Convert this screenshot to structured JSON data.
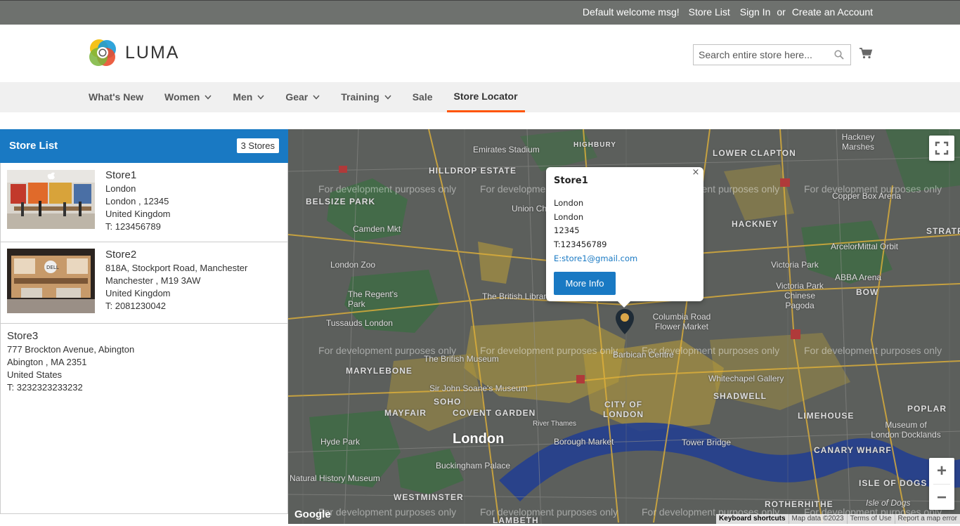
{
  "topbar": {
    "welcome": "Default welcome msg!",
    "store_list": "Store List",
    "sign_in": "Sign In",
    "or": "or",
    "create_account": "Create an Account"
  },
  "header": {
    "logo_text": "LUMA",
    "search_placeholder": "Search entire store here..."
  },
  "nav": {
    "items": [
      {
        "label": "What's New",
        "has_dropdown": false
      },
      {
        "label": "Women",
        "has_dropdown": true
      },
      {
        "label": "Men",
        "has_dropdown": true
      },
      {
        "label": "Gear",
        "has_dropdown": true
      },
      {
        "label": "Training",
        "has_dropdown": true
      },
      {
        "label": "Sale",
        "has_dropdown": false
      },
      {
        "label": "Store Locator",
        "has_dropdown": false,
        "active": true
      }
    ]
  },
  "store_list": {
    "title": "Store List",
    "count_label": "3 Stores",
    "stores": [
      {
        "name": "Store1",
        "line1": "London",
        "line2": "London , 12345",
        "country": "United Kingdom",
        "phone": "T: 123456789"
      },
      {
        "name": "Store2",
        "line1": "818A, Stockport Road, Manchester",
        "line2": "Manchester , M19 3AW",
        "country": "United Kingdom",
        "phone": "T: 2081230042"
      },
      {
        "name": "Store3",
        "line1": "777 Brockton Avenue, Abington",
        "line2": "Abington , MA 2351",
        "country": "United States",
        "phone": "T: 3232323233232"
      }
    ]
  },
  "map": {
    "watermark": "For development purposes only",
    "places": {
      "emirates": "Emirates Stadium",
      "highbury": "HIGHBURY",
      "lower_clapton": "LOWER CLAPTON",
      "hackney_marshes": "Hackney Marshes",
      "hilldrop": "HILLDROP ESTATE",
      "belsize": "BELSIZE PARK",
      "union": "Union Ch",
      "copper_box": "Copper Box Arena",
      "camden": "Camden Mkt",
      "hackney": "HACKNEY",
      "stratford": "STRATFO",
      "arcelor": "ArcelorMittal Orbit",
      "london_zoo": "London Zoo",
      "victoria_park": "Victoria Park",
      "abba": "ABBA Arena",
      "regents_park": "The Regent's Park",
      "british_library": "The British Library",
      "victoria_chinese": "Victoria Park Chinese Pagoda",
      "bow": "BOW",
      "tussauds": "Tussauds London",
      "columbia": "Columbia Road Flower Market",
      "british_museum": "The British Museum",
      "barbican": "Barbican Centre",
      "marylebone": "MARYLEBONE",
      "whitechapel": "Whitechapel Gallery",
      "soane": "Sir John Soane's Museum",
      "soho": "SOHO",
      "shadwell": "SHADWELL",
      "city_of_london": "CITY OF LONDON",
      "mayfair": "MAYFAIR",
      "covent_garden": "COVENT GARDEN",
      "limehouse": "LIMEHOUSE",
      "poplar": "POPLAR",
      "museum_docklands": "Museum of London Docklands",
      "hyde_park": "Hyde Park",
      "london": "London",
      "borough": "Borough Market",
      "tower_bridge": "Tower Bridge",
      "canary": "CANARY WHARF",
      "river": "River Thames",
      "buckingham": "Buckingham Palace",
      "natural_history": "Natural History Museum",
      "isle_of_dogs_caps": "ISLE OF DOGS",
      "westminster": "WESTMINSTER",
      "rotherhithe": "ROTHERHITHE",
      "isle_of_dogs": "Isle of Dogs",
      "lambeth": "LAMBETH"
    },
    "google_logo": "Google",
    "attribution": [
      "Keyboard shortcuts",
      "Map data ©2023",
      "Terms of Use",
      "Report a map error"
    ],
    "zoom_in": "+",
    "zoom_out": "−"
  },
  "info_window": {
    "title": "Store1",
    "lines": [
      "London",
      "London",
      "12345",
      "T:123456789"
    ],
    "email": "E:store1@gmail.com",
    "button": "More Info",
    "close": "×"
  },
  "colors": {
    "accent": "#1979c3",
    "nav_active_border": "#ff5501",
    "topbar_bg": "#6e716e"
  }
}
